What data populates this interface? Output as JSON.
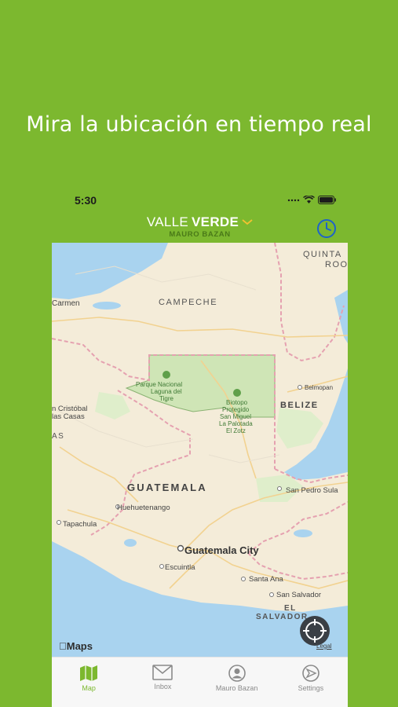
{
  "promo": {
    "title": "Mira la ubicación en tiempo real"
  },
  "status_bar": {
    "time": "5:30"
  },
  "header": {
    "brand_thin": "VALLE",
    "brand_bold": "VERDE",
    "subtitle": "MAURO BAZAN",
    "dropdown_icon": "chevron-down-icon",
    "history_icon": "clock-icon"
  },
  "map": {
    "labels": {
      "quinta": "QUINTA",
      "roo": "ROO",
      "carmen": "Carmen",
      "campeche": "CAMPECHE",
      "parque1": "Parque Nacional",
      "parque2": "Laguna del",
      "parque3": "Tigre",
      "biotopo1": "Biotopo",
      "biotopo2": "Protegido",
      "biotopo3": "San Miguel",
      "biotopo4": "La Palotada",
      "biotopo5": "El Zotz",
      "belmopan": "Belmopan",
      "belize": "BELIZE",
      "cristobal1": "n Cristóbal",
      "cristobal2": "las Casas",
      "as": "AS",
      "guatemala": "GUATEMALA",
      "sanpedro": "San Pedro Sula",
      "huehue": "Huehuetenango",
      "tapachula": "Tapachula",
      "guatecity": "Guatemala City",
      "escuintla": "Escuintla",
      "santaana": "Santa Ana",
      "sansalvador": "San Salvador",
      "elsalvador1": "EL",
      "elsalvador2": "SALVADOR"
    },
    "attribution": "Maps",
    "legal": "Legal"
  },
  "tabs": [
    {
      "label": "Map",
      "icon": "map-icon",
      "active": true
    },
    {
      "label": "Inbox",
      "icon": "envelope-icon",
      "active": false
    },
    {
      "label": "Mauro Bazan",
      "icon": "user-icon",
      "active": false
    },
    {
      "label": "Settings",
      "icon": "compass-icon",
      "active": false
    }
  ],
  "colors": {
    "brand_green": "#7cb82f",
    "water": "#a9d3ef",
    "land": "#f4ecd9",
    "park": "#cfe5b6"
  }
}
